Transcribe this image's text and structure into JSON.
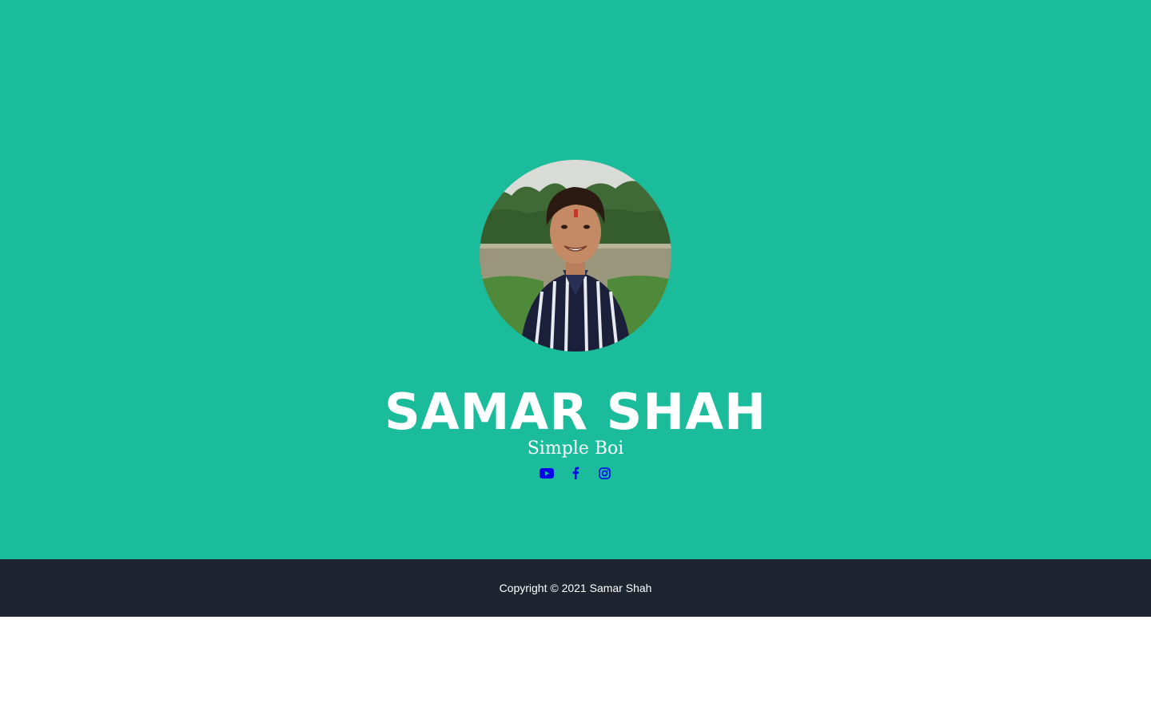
{
  "profile": {
    "name": "SAMAR SHAH",
    "tagline": "Simple Boi"
  },
  "social": [
    {
      "icon": "youtube-icon"
    },
    {
      "icon": "facebook-icon"
    },
    {
      "icon": "instagram-icon"
    }
  ],
  "footer": {
    "copyright": "Copyright © 2021 Samar Shah"
  },
  "colors": {
    "hero_background": "#1abc9c",
    "footer_background": "#1e2530",
    "icon_color": "#0000ee",
    "text_color": "#ffffff"
  }
}
